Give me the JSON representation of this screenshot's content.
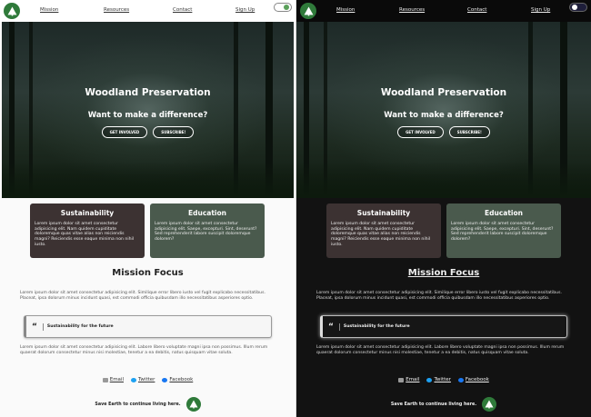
{
  "nav": {
    "links": [
      "Mission",
      "Resources",
      "Contact",
      "Sign Up"
    ]
  },
  "hero": {
    "title": "Woodland Preservation",
    "subtitle": "Want to make a difference?",
    "get_involved": "GET INVOLVED",
    "subscribe": "SUBSCRIBE!"
  },
  "cards": [
    {
      "title": "Sustainability",
      "text": "Lorem ipsum dolor sit amet consectetur adipisicing elit. Nam quidem cupiditate doloremque quas vitae alias non reiciendis magni? Reiciendis esse eaque minima non nihil iusto."
    },
    {
      "title": "Education",
      "text": "Lorem ipsum dolor sit amet consectetur adipisicing elit. Saepe, excepturi. Sint, deserunt? Sed reprehenderit labore suscipit doloremque dolorem?"
    }
  ],
  "mission": {
    "heading": "Mission Focus",
    "para1": "Lorem ipsum dolor sit amet consectetur adipisicing elit. Similique error libero iusto vel fugit explicabo necessitatibus. Placeat, ipsa dolorum minus incidunt quasi, est commodi officia quibusdam illo necessitatibus asperiores optio.",
    "quote": "Sustainability for the future",
    "para2": "Lorem ipsum dolor sit amet consectetur adipisicing elit. Labore libero voluptate magni ipsa non possimus. Illum rerum quaerat dolorum consectetur minus nisi molestiae, tenetur a ea debitis, natus quisquam vitae soluta."
  },
  "social": {
    "email": "Email",
    "twitter": "Twitter",
    "facebook": "Facebook"
  },
  "footer": {
    "text": "Save Earth to continue living here."
  },
  "colors": {
    "brand_green": "#2f7a3a",
    "card_sustainability": "#3c3232",
    "card_education": "#4a5a4d"
  }
}
